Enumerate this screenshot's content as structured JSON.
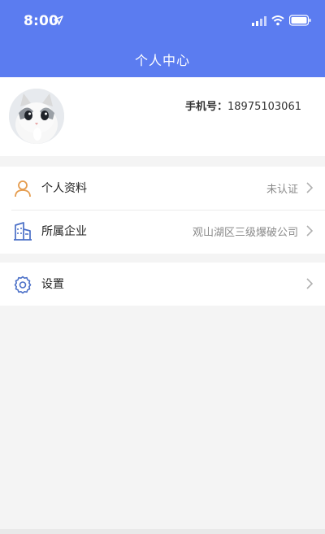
{
  "status_bar": {
    "time": "8:00",
    "icons": [
      "location-arrow-icon",
      "signal-icon",
      "wifi-icon",
      "battery-icon"
    ]
  },
  "header": {
    "title": "个人中心",
    "color": "#5b7cf0"
  },
  "profile": {
    "phone_label": "手机号：",
    "phone_value": "18975103061",
    "avatar": "cat-avatar-photo"
  },
  "menu": {
    "items": [
      {
        "icon": "user-icon",
        "label": "个人资料",
        "value": "未认证"
      },
      {
        "icon": "building-icon",
        "label": "所属企业",
        "value": "观山湖区三级爆破公司"
      }
    ],
    "settings": {
      "icon": "gear-icon",
      "label": "设置"
    }
  }
}
